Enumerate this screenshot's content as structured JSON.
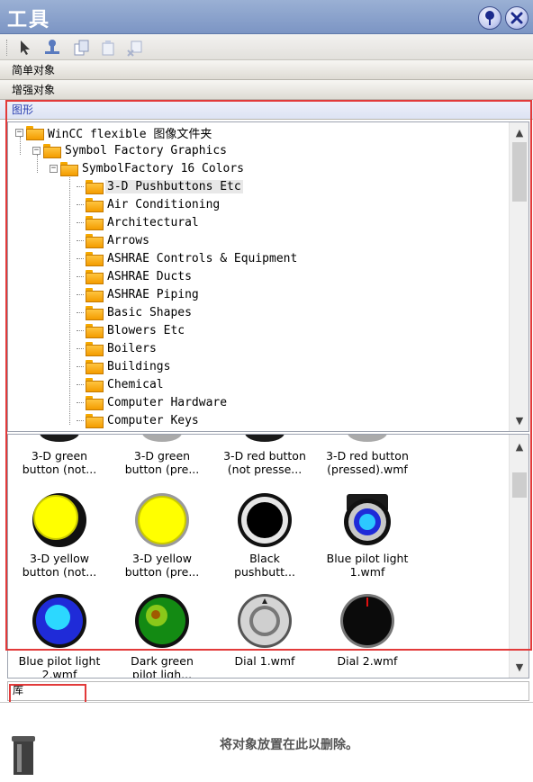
{
  "window": {
    "title": "工具"
  },
  "sections": {
    "simple_objects": "简单对象",
    "enhanced_objects": "增强对象",
    "graphics": "图形",
    "library": "库"
  },
  "tree": {
    "items": [
      {
        "label": "WinCC flexible 图像文件夹",
        "level": 0,
        "expanded": true
      },
      {
        "label": "Symbol Factory Graphics",
        "level": 1,
        "expanded": true
      },
      {
        "label": "SymbolFactory 16 Colors",
        "level": 2,
        "expanded": true
      },
      {
        "label": "3-D Pushbuttons Etc",
        "level": 3,
        "selected": true
      },
      {
        "label": "Air Conditioning",
        "level": 3
      },
      {
        "label": "Architectural",
        "level": 3
      },
      {
        "label": "Arrows",
        "level": 3
      },
      {
        "label": "ASHRAE Controls & Equipment",
        "level": 3
      },
      {
        "label": "ASHRAE Ducts",
        "level": 3
      },
      {
        "label": "ASHRAE Piping",
        "level": 3
      },
      {
        "label": "Basic Shapes",
        "level": 3
      },
      {
        "label": "Blowers Etc",
        "level": 3
      },
      {
        "label": "Boilers",
        "level": 3
      },
      {
        "label": "Buildings",
        "level": 3
      },
      {
        "label": "Chemical",
        "level": 3
      },
      {
        "label": "Computer Hardware",
        "level": 3
      },
      {
        "label": "Computer Keys",
        "level": 3
      }
    ]
  },
  "symbols": {
    "row0": [
      {
        "line1": "3-D green",
        "line2": "button (not..."
      },
      {
        "line1": "3-D green",
        "line2": "button (pre..."
      },
      {
        "line1": "3-D red button",
        "line2": "(not presse..."
      },
      {
        "line1": "3-D red button",
        "line2": "(pressed).wmf"
      }
    ],
    "row1": [
      {
        "line1": "3-D yellow",
        "line2": "button (not..."
      },
      {
        "line1": "3-D yellow",
        "line2": "button (pre..."
      },
      {
        "line1": "Black",
        "line2": "pushbutt..."
      },
      {
        "line1": "Blue pilot light",
        "line2": "1.wmf"
      }
    ],
    "row2": [
      {
        "line1": "Blue pilot light",
        "line2": "2.wmf"
      },
      {
        "line1": "Dark green",
        "line2": "pilot ligh..."
      },
      {
        "line1": "Dial 1.wmf",
        "line2": ""
      },
      {
        "line1": "Dial 2.wmf",
        "line2": ""
      }
    ]
  },
  "drop_area": {
    "text": "将对象放置在此以删除。"
  },
  "colors": {
    "title_bar": "#7c95c4",
    "highlight": "#e23a3a",
    "folder": "#f5a800"
  }
}
